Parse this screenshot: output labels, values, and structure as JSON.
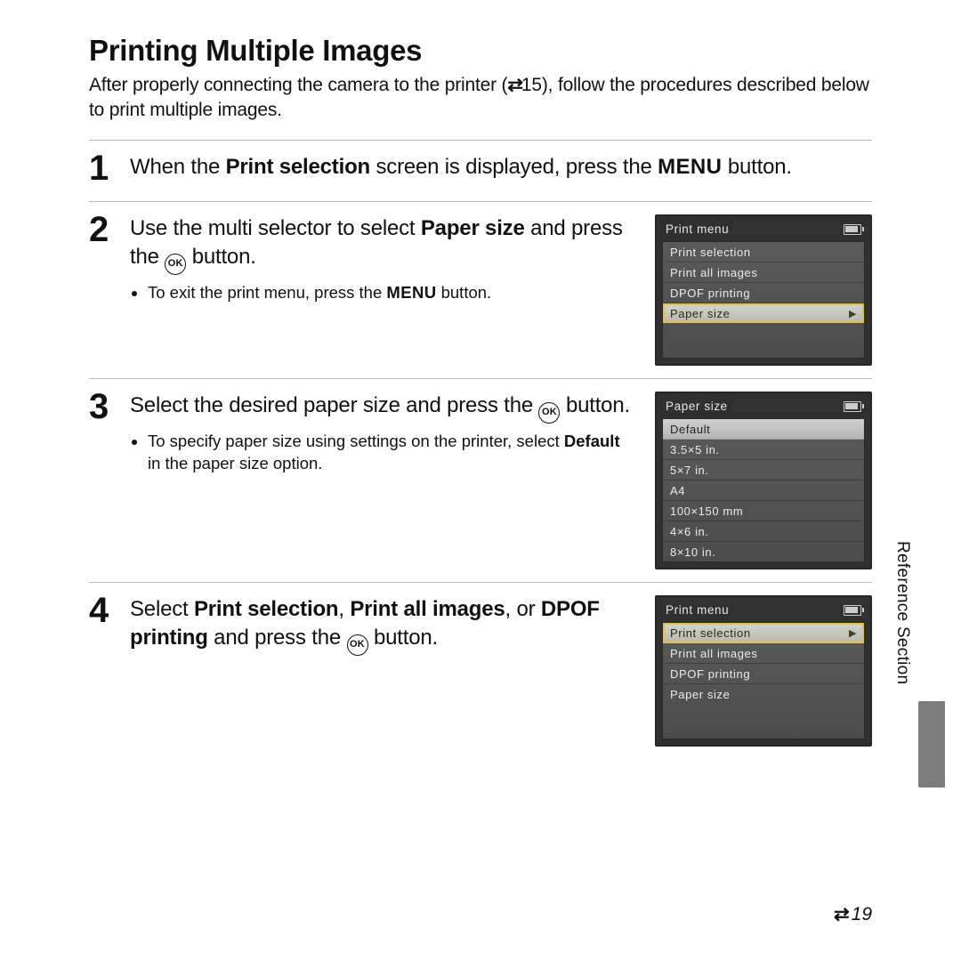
{
  "title": "Printing Multiple Images",
  "intro_pre": "After properly connecting the camera to the printer (",
  "intro_ref": "E",
  "intro_refnum": "15",
  "intro_post": "), follow the procedures described below to print multiple images.",
  "menu_word": "MENU",
  "ok_label": "OK",
  "steps": {
    "s1": {
      "num": "1",
      "line_a": "When the ",
      "bold_a": "Print selection",
      "line_b": " screen is displayed, press the ",
      "line_c": " button."
    },
    "s2": {
      "num": "2",
      "line_a": "Use the multi selector to select ",
      "bold_a": "Paper size",
      "line_b": " and press the ",
      "line_c": " button.",
      "sub1_a": "To exit the print menu, press the ",
      "sub1_b": " button."
    },
    "s3": {
      "num": "3",
      "line_a": "Select the desired paper size and press the ",
      "line_b": " button.",
      "sub1_a": "To specify paper size using settings on the printer, select ",
      "sub1_bold": "Default",
      "sub1_b": " in the paper size option."
    },
    "s4": {
      "num": "4",
      "line_a": "Select ",
      "bold_a": "Print selection",
      "line_b": ", ",
      "bold_b": "Print all images",
      "line_c": ", or ",
      "bold_c": "DPOF printing",
      "line_d": " and press the ",
      "line_e": " button."
    }
  },
  "lcd1": {
    "title": "Print menu",
    "items": [
      "Print selection",
      "Print all images",
      "DPOF printing",
      "Paper size"
    ],
    "selected_index": 3,
    "arrow_on_selected": true
  },
  "lcd2": {
    "title": "Paper size",
    "items": [
      "Default",
      "3.5×5 in.",
      "5×7 in.",
      "A4",
      "100×150 mm",
      "4×6 in.",
      "8×10 in."
    ],
    "selected_index": 0
  },
  "lcd3": {
    "title": "Print menu",
    "items": [
      "Print selection",
      "Print all images",
      "DPOF printing",
      "Paper size"
    ],
    "selected_index": 0,
    "arrow_on_selected": true
  },
  "sidetext": "Reference Section",
  "footer": {
    "glyph": "E",
    "num": "19"
  }
}
